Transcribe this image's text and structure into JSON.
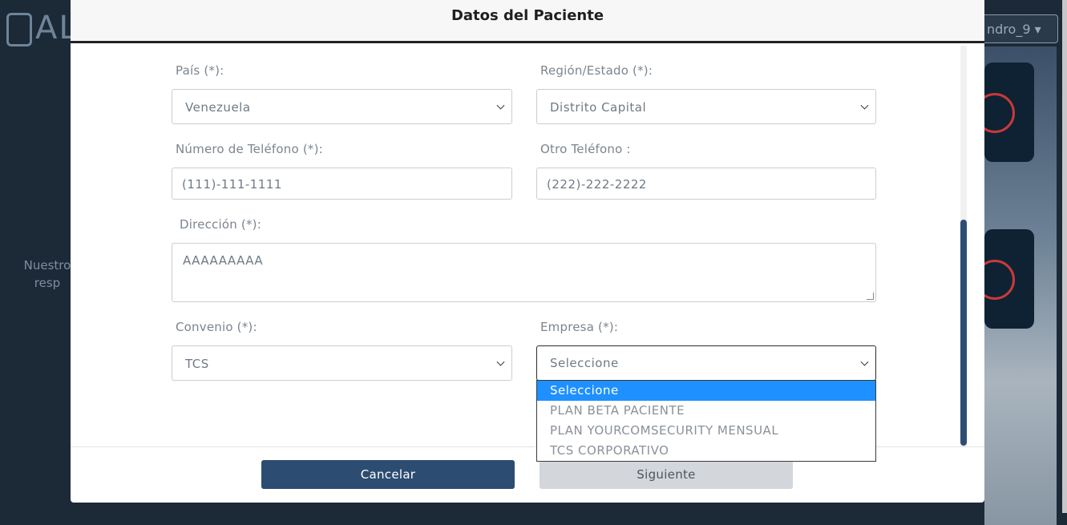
{
  "background": {
    "logo_text": "ALO",
    "user_menu": "ndro_9 ▾",
    "side_text_1": "Nuestro",
    "side_text_2": "resp"
  },
  "modal": {
    "title": "Datos del Paciente"
  },
  "form": {
    "pais_label": "País (*):",
    "pais_value": "Venezuela",
    "region_label": "Región/Estado (*):",
    "region_value": "Distrito Capital",
    "telefono_label": "Número de Teléfono (*):",
    "telefono_value": "(111)-111-1111",
    "otro_telefono_label": "Otro Teléfono :",
    "otro_telefono_value": "(222)-222-2222",
    "direccion_label": "Dirección (*):",
    "direccion_value": "AAAAAAAAA",
    "convenio_label": "Convenio (*):",
    "convenio_value": "TCS",
    "empresa_label": "Empresa (*):",
    "empresa_value": "Seleccione"
  },
  "empresa_options": [
    "Seleccione",
    "PLAN BETA PACIENTE",
    "PLAN YOURCOMSECURITY MENSUAL",
    "TCS CORPORATIVO"
  ],
  "empresa_selected_index": 0,
  "buttons": {
    "cancel": "Cancelar",
    "next": "Siguiente"
  },
  "colors": {
    "primary": "#2c4c72",
    "highlight": "#1e90ff",
    "disabled": "#d3d6da"
  }
}
